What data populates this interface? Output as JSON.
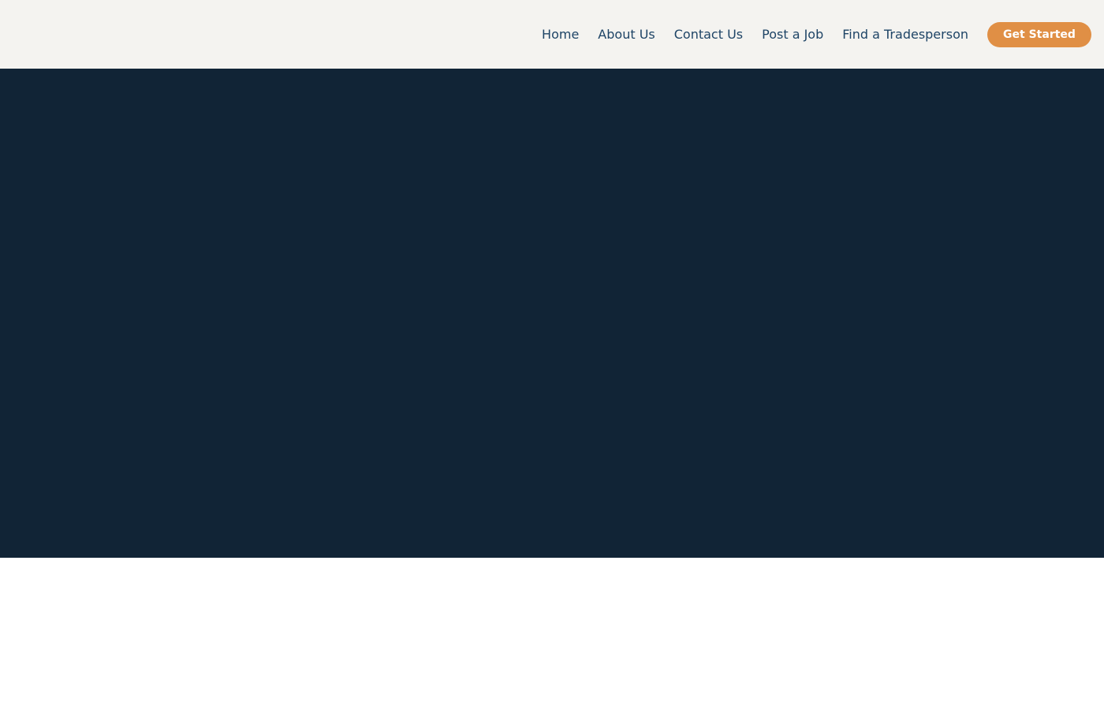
{
  "header": {
    "nav": [
      {
        "label": "Home"
      },
      {
        "label": "About Us"
      },
      {
        "label": "Contact Us"
      },
      {
        "label": "Post a Job"
      },
      {
        "label": "Find a Tradesperson"
      }
    ],
    "cta_label": "Get Started"
  },
  "colors": {
    "header_bg": "#f4f3f0",
    "nav_text": "#1e4466",
    "cta_bg": "#e08f45",
    "hero_bg": "#112436",
    "page_bg": "#ffffff"
  }
}
